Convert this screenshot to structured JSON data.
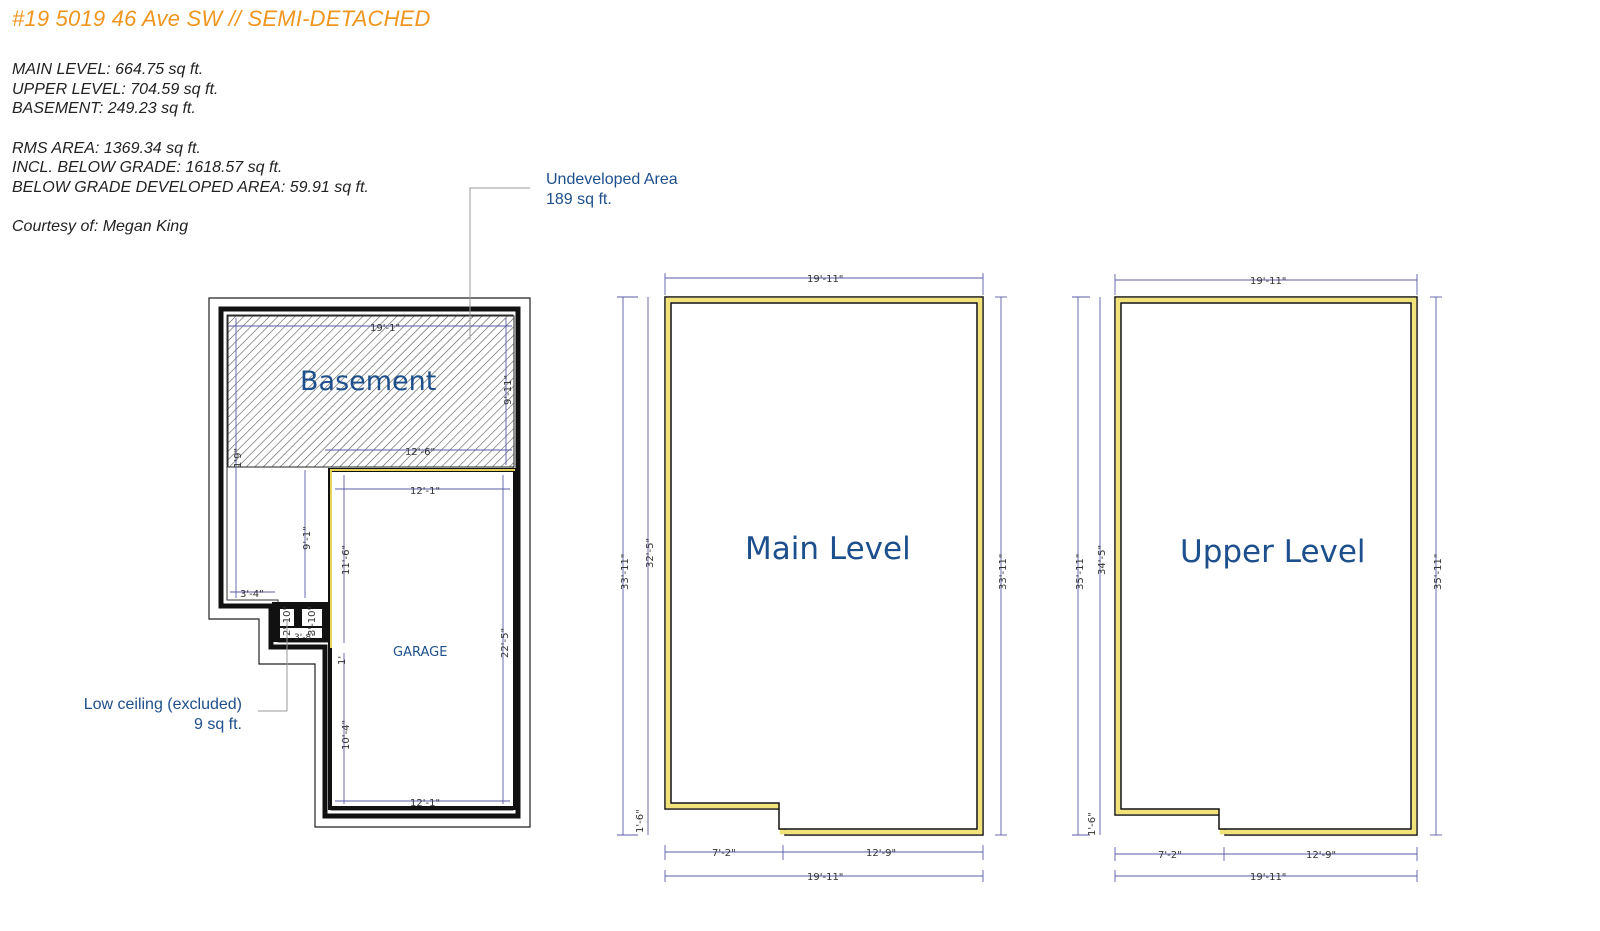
{
  "title": "#19 5019 46 Ave SW // SEMI-DETACHED",
  "stats": {
    "main_level": "MAIN LEVEL: 664.75 sq ft.",
    "upper_level": "UPPER LEVEL: 704.59 sq ft.",
    "basement": "BASEMENT: 249.23 sq ft.",
    "rms_area": "RMS AREA: 1369.34 sq ft.",
    "incl_below_grade": "INCL. BELOW GRADE: 1618.57 sq ft.",
    "below_grade_developed": "BELOW GRADE DEVELOPED AREA: 59.91 sq ft.",
    "courtesy": "Courtesy of: Megan King"
  },
  "callouts": {
    "undeveloped_line1": "Undeveloped Area",
    "undeveloped_line2": "189 sq ft.",
    "low_ceiling_line1": "Low ceiling (excluded)",
    "low_ceiling_line2": "9 sq ft."
  },
  "basement_plan": {
    "label": "Basement",
    "garage_label": "GARAGE",
    "dims": {
      "top_width": "19'-1\"",
      "right_height": "9'-11\"",
      "left_small": "1'9\"",
      "mid_width": "12'-6\"",
      "hall_height": "9'-1\"",
      "hall_width": "3'-4\"",
      "closet_a": "2'-10\"",
      "closet_b": "3'-10\"",
      "closet_c": "3'-8\"",
      "garage_top": "12'-1\"",
      "garage_left_upper": "11'-6\"",
      "garage_right": "22'-5\"",
      "garage_step": "1'",
      "garage_left_lower": "10'-4\"",
      "garage_bottom": "12'-1\""
    }
  },
  "main_plan": {
    "label": "Main Level",
    "dims": {
      "top": "19'-11\"",
      "left_outer": "33'-11\"",
      "left_inner": "32'-5\"",
      "right": "33'-11\"",
      "step": "1'-6\"",
      "bottom_left": "7'-2\"",
      "bottom_right": "12'-9\"",
      "bottom_total": "19'-11\""
    }
  },
  "upper_plan": {
    "label": "Upper Level",
    "dims": {
      "top": "19'-11\"",
      "left_outer": "35'-11\"",
      "left_inner": "34'-5\"",
      "right": "35'-11\"",
      "step": "1'-6\"",
      "bottom_left": "7'-2\"",
      "bottom_right": "12'-9\"",
      "bottom_total": "19'-11\""
    }
  },
  "colors": {
    "title": "#f0961e",
    "label_blue": "#1d4f8c",
    "wall_yellow": "#f1e27a",
    "dim_line": "#5b5ba8"
  }
}
